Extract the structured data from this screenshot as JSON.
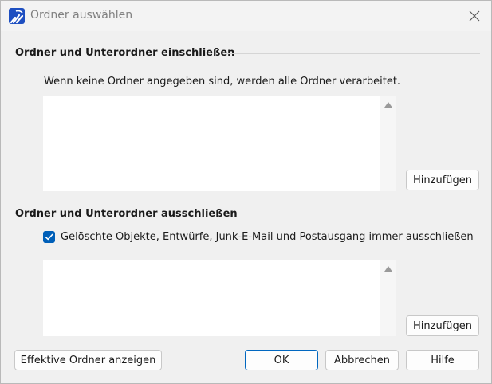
{
  "window": {
    "title": "Ordner auswählen",
    "icon": "outlook-folder-app-icon",
    "close_icon": "close-icon"
  },
  "include": {
    "heading": "Ordner und Unterordner einschließen",
    "hint": "Wenn keine Ordner angegeben sind, werden alle Ordner verarbeitet.",
    "items": [],
    "add_label": "Hinzufügen"
  },
  "exclude": {
    "heading": "Ordner und Unterordner ausschließen",
    "checkbox_label": "Gelöschte Objekte, Entwürfe, Junk-E-Mail und Postausgang immer ausschließen",
    "checkbox_checked": true,
    "items": [],
    "add_label": "Hinzufügen"
  },
  "footer": {
    "effective_label": "Effektive Ordner anzeigen",
    "ok_label": "OK",
    "cancel_label": "Abbrechen",
    "help_label": "Hilfe"
  },
  "colors": {
    "accent": "#005fb8",
    "default_button_border": "#0067c0",
    "app_icon_bg": "#1e4fc1"
  }
}
